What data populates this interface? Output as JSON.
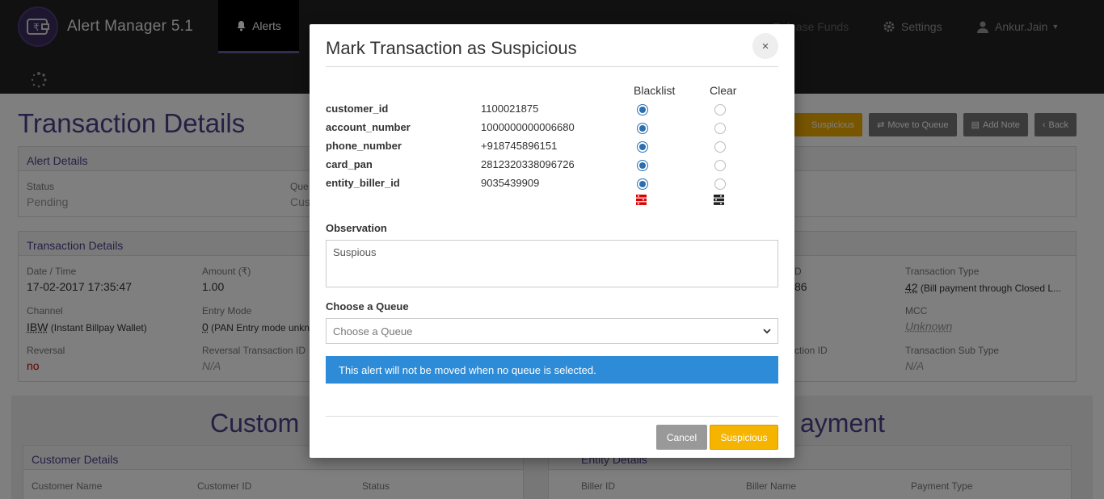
{
  "app": {
    "name": "Alert Manager 5.1"
  },
  "nav": {
    "items": [
      {
        "label": "Alerts"
      },
      {
        "label": "Settings"
      },
      {
        "label": "Ankur.Jain"
      }
    ],
    "partial": [
      {
        "label": "Release Funds"
      }
    ]
  },
  "page": {
    "title": "Transaction Details",
    "toolbar": {
      "suspicious": "Suspicious",
      "move": "Move to Queue",
      "note": "Add Note",
      "back": "Back"
    }
  },
  "alert_details": {
    "header": "Alert Details",
    "status_label": "Status",
    "status_value": "Pending",
    "queue_label": "Que",
    "queue_value": "Cus"
  },
  "txn_details": {
    "header": "Transaction Details",
    "date_label": "Date / Time",
    "date_value": "17-02-2017 17:35:47",
    "amount_label": "Amount (₹)",
    "amount_value": "1.00",
    "channel_label": "Channel",
    "channel_code": "IBW",
    "channel_desc": "(Instant Billpay Wallet)",
    "entry_label": "Entry Mode",
    "entry_code": "0",
    "entry_desc": "(PAN Entry mode unkn",
    "reversal_label": "Reversal",
    "reversal_value": "no",
    "revtxn_label": "Reversal Transaction ID",
    "revtxn_value": "N/A",
    "col3_label": "D",
    "col3_value": "86",
    "txntype_label": "Transaction Type",
    "txntype_code": "42",
    "txntype_desc": "(Bill payment through Closed L...",
    "mcc_label": "MCC",
    "mcc_value": "Unknown",
    "col3b_label": "ction ID",
    "subtype_label": "Transaction Sub Type",
    "subtype_value": "N/A"
  },
  "customer_section": {
    "heading": "Custom",
    "panel_header": "Customer Details",
    "name_label": "Customer Name",
    "id_label": "Customer ID",
    "status_label": "Status"
  },
  "payment_section": {
    "heading": "ayment",
    "panel_header": "Entity Details",
    "biller_id_label": "Biller ID",
    "biller_name_label": "Biller Name",
    "payment_type_label": "Payment Type"
  },
  "modal": {
    "title": "Mark Transaction as Suspicious",
    "close": "×",
    "col_blacklist": "Blacklist",
    "col_clear": "Clear",
    "rows": [
      {
        "label": "customer_id",
        "value": "1100021875",
        "blacklist": true
      },
      {
        "label": "account_number",
        "value": "1000000000006680",
        "blacklist": true
      },
      {
        "label": "phone_number",
        "value": "+918745896151",
        "blacklist": true
      },
      {
        "label": "card_pan",
        "value": "2812320338096726",
        "blacklist": true
      },
      {
        "label": "entity_biller_id",
        "value": "9035439909",
        "blacklist": true
      }
    ],
    "observation_label": "Observation",
    "observation_value": "Suspious",
    "queue_label": "Choose a Queue",
    "queue_placeholder": "Choose a Queue",
    "info": "This alert will not be moved when no queue is selected.",
    "cancel": "Cancel",
    "submit": "Suspicious"
  },
  "colors": {
    "accent": "#4d3f8a",
    "warning": "#f5b400",
    "info": "#2d8bd7"
  }
}
